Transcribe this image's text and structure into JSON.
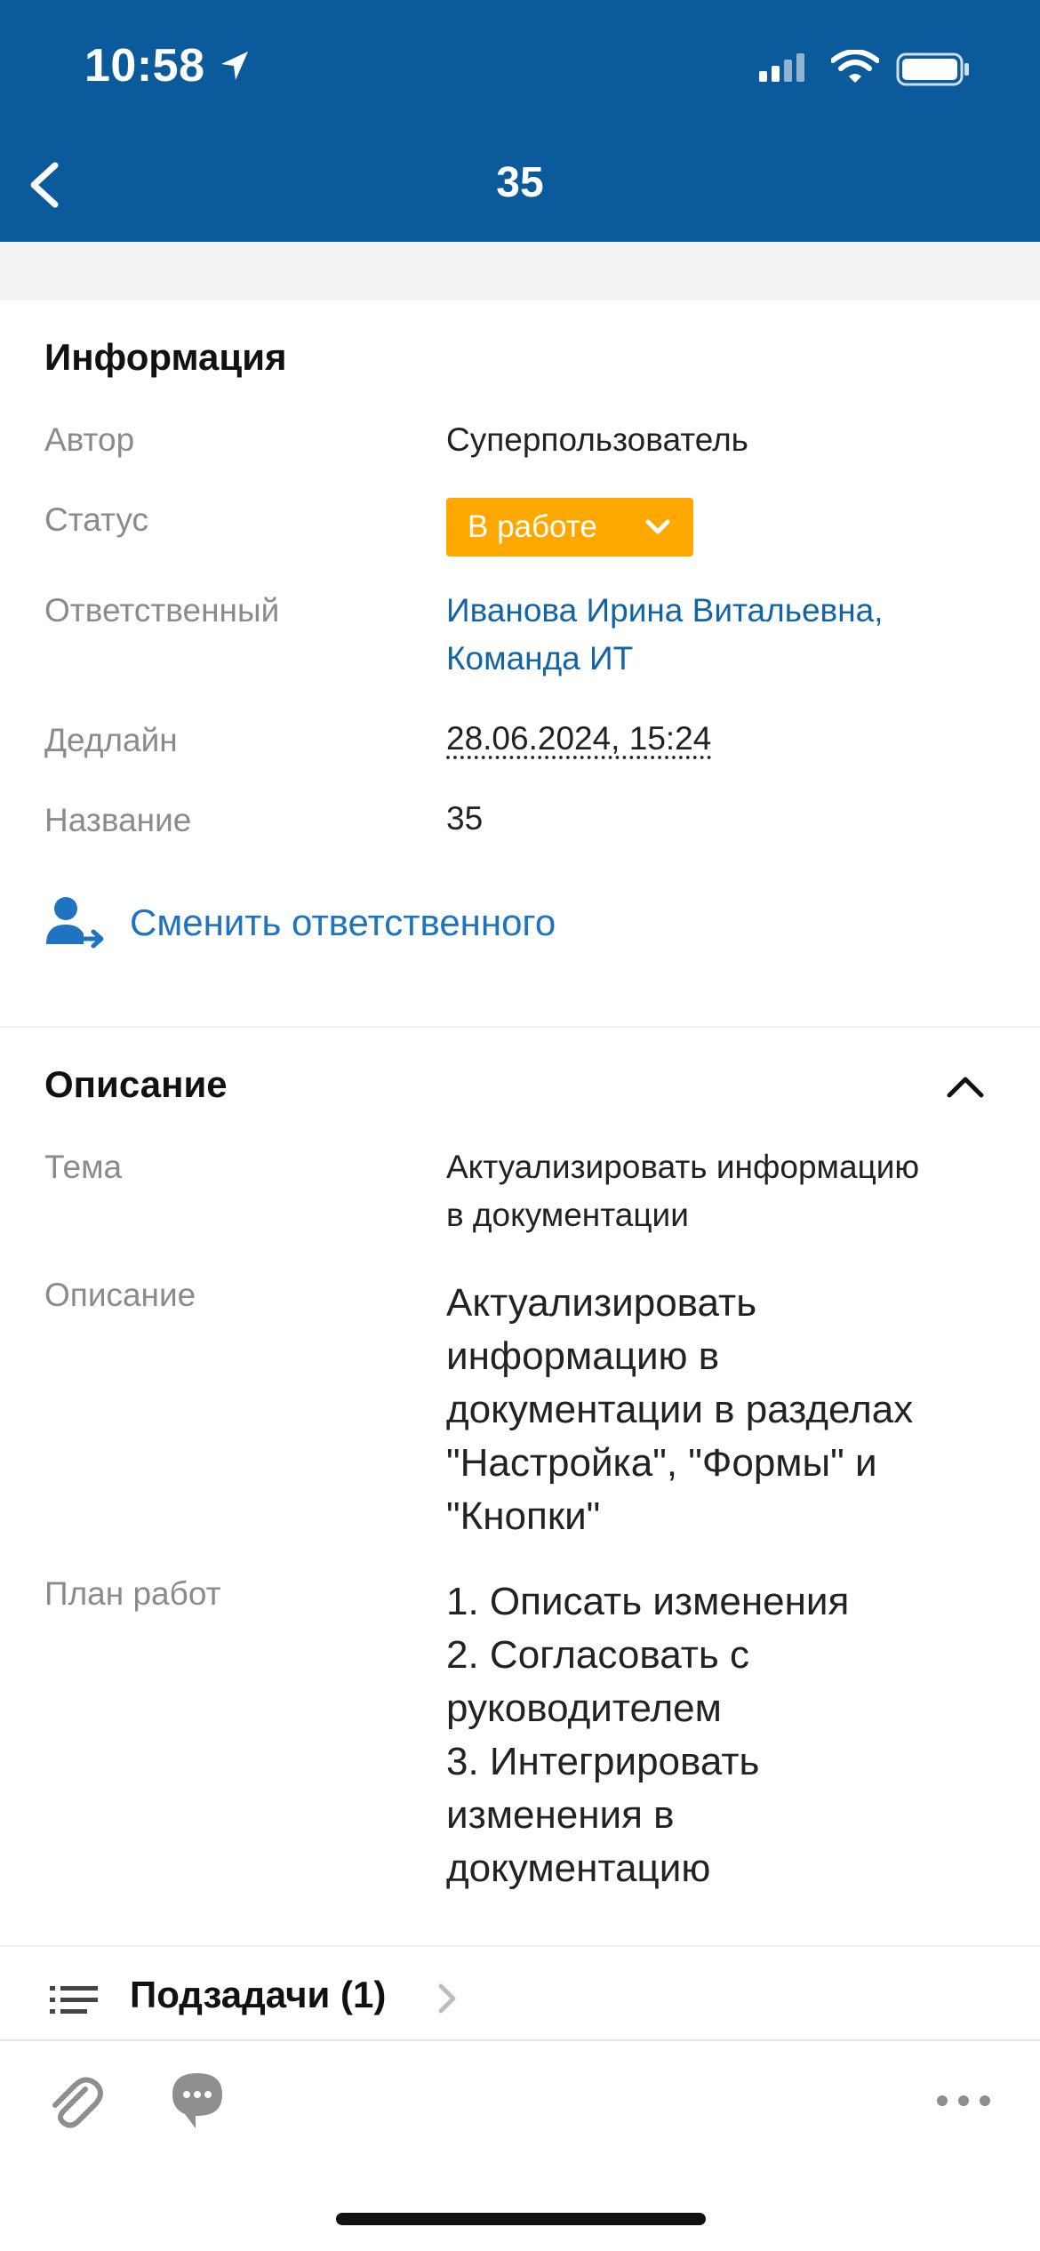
{
  "status_bar": {
    "time": "10:58"
  },
  "nav": {
    "title": "35"
  },
  "info": {
    "section_title": "Информация",
    "author_label": "Автор",
    "author_value": "Суперпользователь",
    "status_label": "Статус",
    "status_value": "В работе",
    "status_color": "#ffa800",
    "responsible_label": "Ответственный",
    "responsible_line1": "Иванова Ирина Витальевна,",
    "responsible_line2": "Команда ИТ",
    "deadline_label": "Дедлайн",
    "deadline_value": "28.06.2024, 15:24",
    "name_label": "Название",
    "name_value": "35",
    "change_responsible": "Сменить ответственного"
  },
  "description": {
    "section_title": "Описание",
    "topic_label": "Тема",
    "topic_line1": "Актуализировать информацию",
    "topic_line2": "в документации",
    "desc_label": "Описание",
    "desc_lines": [
      "Актуализировать",
      "информацию в",
      "документации в разделах",
      "\"Настройка\", \"Формы\" и",
      "\"Кнопки\""
    ],
    "plan_label": "План работ",
    "plan_lines": [
      "1. Описать изменения",
      "2. Согласовать с",
      "руководителем",
      "3. Интегрировать",
      "изменения в",
      "документацию"
    ]
  },
  "subtasks": {
    "label": "Подзадачи (1)"
  },
  "colors": {
    "header": "#0b5a9b",
    "link": "#1264a8",
    "action": "#1f73c1"
  }
}
